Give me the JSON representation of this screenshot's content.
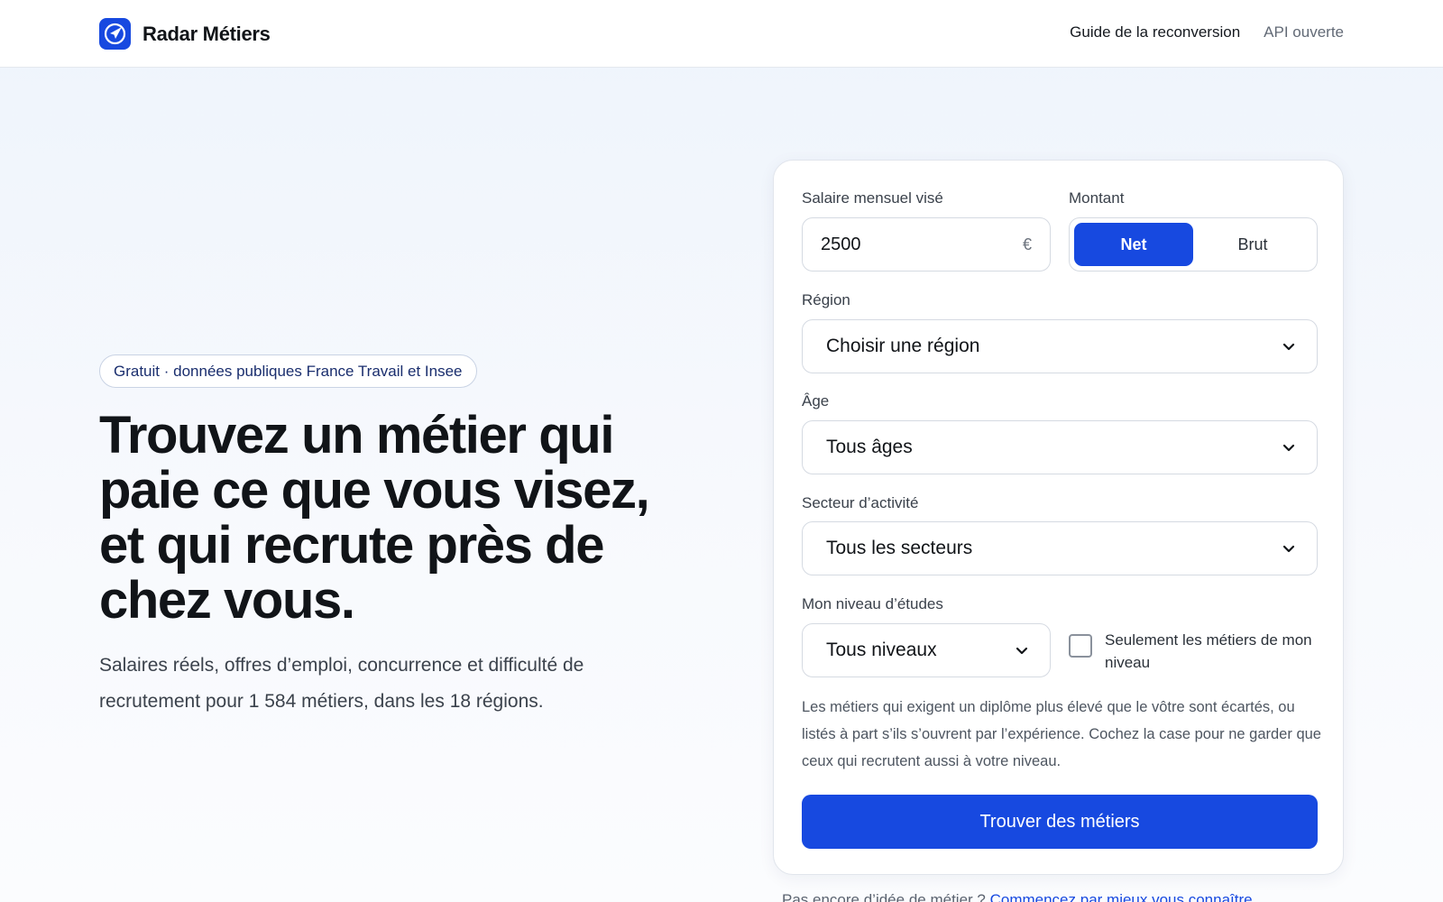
{
  "header": {
    "brand_name": "Radar Métiers",
    "nav": {
      "guide": "Guide de la reconversion",
      "api": "API ouverte"
    }
  },
  "hero": {
    "badge": "Gratuit · données publiques France Travail et Insee",
    "title": "Trouvez un métier qui paie ce que vous visez, et qui recrute près de chez vous.",
    "subtitle": "Salaires réels, offres d’emploi, concurrence et difficulté de recrutement pour 1 584 métiers, dans les 18 régions."
  },
  "form": {
    "salary_label": "Salaire mensuel visé",
    "salary_value": "2500",
    "currency_symbol": "€",
    "amount_label": "Montant",
    "amount_options": [
      "Net",
      "Brut"
    ],
    "amount_selected": "Net",
    "region_label": "Région",
    "region_value": "Choisir une région",
    "age_label": "Âge",
    "age_value": "Tous âges",
    "sector_label": "Secteur d’activité",
    "sector_value": "Tous les secteurs",
    "education_label": "Mon niveau d’études",
    "education_value": "Tous niveaux",
    "only_my_level_label": "Seulement les métiers de mon niveau",
    "only_my_level_checked": false,
    "help_text": "Les métiers qui exigent un diplôme plus élevé que le vôtre sont écartés, ou listés à part s’ils s’ouvrent par l’expérience. Cochez la case pour ne garder que ceux qui recrutent aussi à votre niveau.",
    "submit_label": "Trouver des métiers"
  },
  "footer_hint": {
    "text": "Pas encore d’idée de métier ?",
    "link": "Commencez par mieux vous connaître"
  },
  "colors": {
    "accent": "#1749e0",
    "text": "#111418",
    "muted": "#4d5560"
  },
  "icons": {
    "logo": "paper-plane-icon",
    "select_chevron": "chevron-down-icon"
  }
}
